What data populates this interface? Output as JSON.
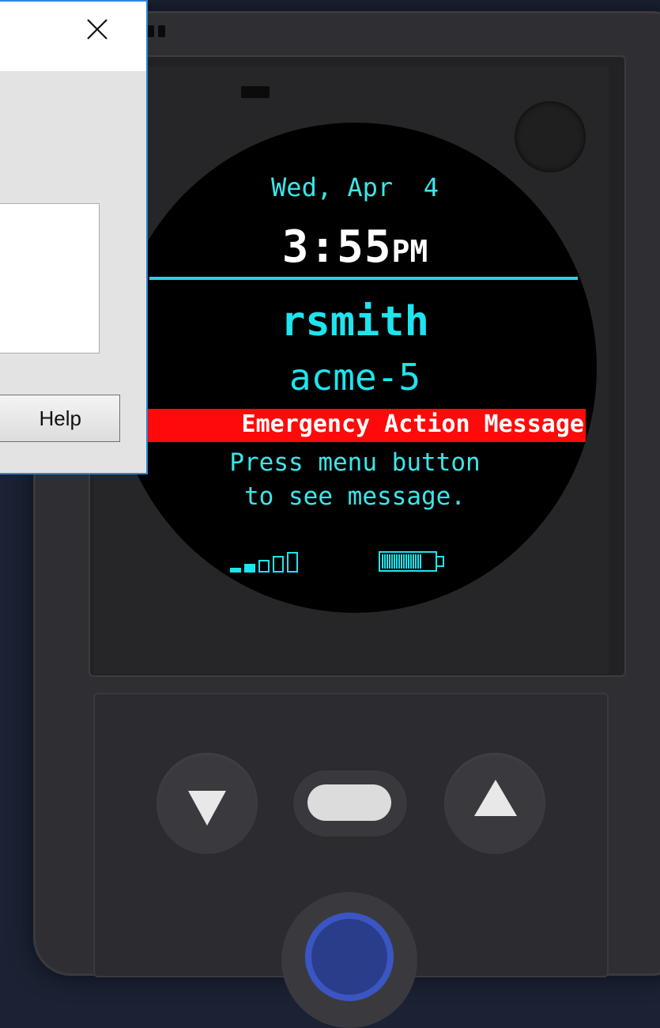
{
  "dialog": {
    "close_icon": "close-icon",
    "help_label": "Help"
  },
  "display": {
    "date": "Wed, Apr  4",
    "time": "3:55",
    "ampm": "PM",
    "username": "rsmith",
    "device_name": "acme-5",
    "alert": "Emergency Action Message",
    "instruction_line1": "Press menu button",
    "instruction_line2": "to see message.",
    "signal_icon": "signal-strength-icon",
    "signal_bars_filled": 2,
    "signal_bars_total": 5,
    "battery_icon": "battery-icon",
    "battery_level": 0.75
  },
  "keypad": {
    "down_icon": "down-arrow-icon",
    "up_icon": "up-arrow-icon",
    "menu_icon": "menu-button-icon",
    "power_icon": "power-button-icon"
  },
  "colors": {
    "accent_cyan": "#1ee4ef",
    "alert_red": "#ff0a0a",
    "device_body": "#2f2f33"
  }
}
